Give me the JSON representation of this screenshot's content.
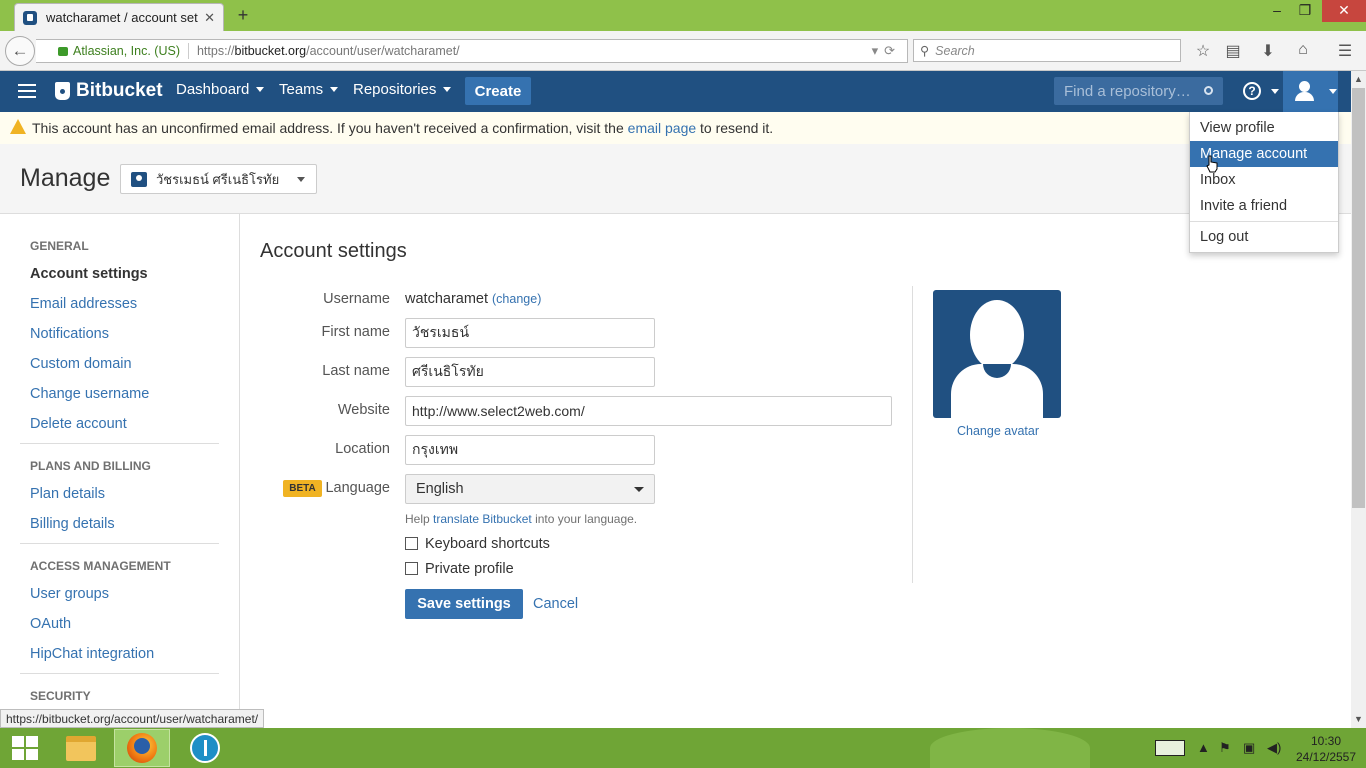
{
  "browser": {
    "tab_title": "watcharamet / account set...",
    "tab_close": "✕",
    "new_tab": "+",
    "window_controls": {
      "minimize": "–",
      "restore": "❐",
      "close": "✕"
    },
    "url_org": "Atlassian, Inc. (US)",
    "url_prefix": "https://",
    "url_host": "bitbucket.org",
    "url_path": "/account/user/watcharamet/",
    "search_placeholder": "Search",
    "toolbar_icons": [
      "bookmark-star-icon",
      "reading-list-icon",
      "download-icon",
      "home-icon",
      "menu-icon"
    ],
    "status_url": "https://bitbucket.org/account/user/watcharamet/"
  },
  "header": {
    "logo": "Bitbucket",
    "nav": [
      "Dashboard",
      "Teams",
      "Repositories"
    ],
    "create": "Create",
    "find_placeholder": "Find a repository…",
    "help": "?"
  },
  "warning": {
    "before": "This account has an unconfirmed email address. If you haven't received a confirmation, visit the ",
    "link": "email page",
    "after": " to resend it."
  },
  "manage": {
    "title": "Manage",
    "selected_user": "วัชรเมธน์ ศรีเนธิโรทัย"
  },
  "sidebar": {
    "general": {
      "header": "GENERAL",
      "items": [
        "Account settings",
        "Email addresses",
        "Notifications",
        "Custom domain",
        "Change username",
        "Delete account"
      ]
    },
    "plans": {
      "header": "PLANS AND BILLING",
      "items": [
        "Plan details",
        "Billing details"
      ]
    },
    "access": {
      "header": "ACCESS MANAGEMENT",
      "items": [
        "User groups",
        "OAuth",
        "HipChat integration"
      ]
    },
    "security": {
      "header": "SECURITY"
    }
  },
  "form": {
    "title": "Account settings",
    "username_label": "Username",
    "username": "watcharamet",
    "change": "(change)",
    "first_name_label": "First name",
    "first_name": "วัชรเมธน์",
    "last_name_label": "Last name",
    "last_name": "ศรีเนธิโรทัย",
    "website_label": "Website",
    "website": "http://www.select2web.com/",
    "location_label": "Location",
    "location": "กรุงเทพ",
    "beta": "BETA",
    "language_label": "Language",
    "language": "English",
    "help_before": "Help ",
    "help_link": "translate Bitbucket",
    "help_after": " into your language.",
    "keyboard_shortcuts": "Keyboard shortcuts",
    "keyboard_shortcuts_checked": false,
    "private_profile": "Private profile",
    "private_profile_checked": false,
    "save": "Save settings",
    "cancel": "Cancel",
    "change_avatar": "Change avatar"
  },
  "user_menu": {
    "items": [
      "View profile",
      "Manage account",
      "Inbox",
      "Invite a friend"
    ],
    "logout": "Log out",
    "highlighted": "Manage account"
  },
  "taskbar": {
    "time": "10:30",
    "date": "24/12/2557"
  },
  "colors": {
    "header": "#205081",
    "primary": "#3572b0",
    "warning_icon": "#f0b323",
    "browser_frame": "#8fc14a"
  }
}
